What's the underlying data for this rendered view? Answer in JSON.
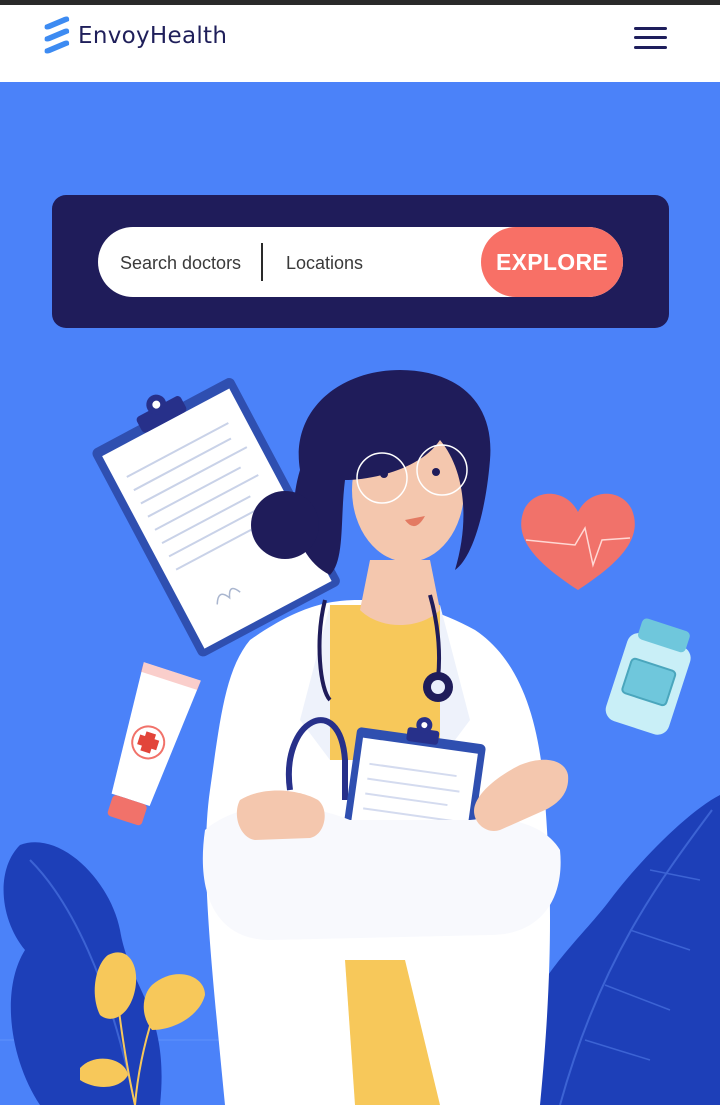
{
  "brand": {
    "name": "EnvoyHealth",
    "logo_icon": "stacked-chevrons-logo-icon",
    "accent": "#3d8bf2"
  },
  "nav": {
    "menu_icon": "hamburger-menu-icon"
  },
  "search": {
    "doctor_placeholder": "Search doctors",
    "location_placeholder": "Locations",
    "button_label": "EXPLORE"
  },
  "colors": {
    "hero_bg": "#4b82f9",
    "panel_bg": "#1f1c5a",
    "button_bg": "#f87066"
  },
  "illustration": {
    "subject": "doctor-illustration",
    "items": [
      "clipboard-icon",
      "heart-icon",
      "pill-bottle-icon",
      "ointment-tube-icon",
      "stethoscope-icon",
      "leaf-icon"
    ]
  }
}
